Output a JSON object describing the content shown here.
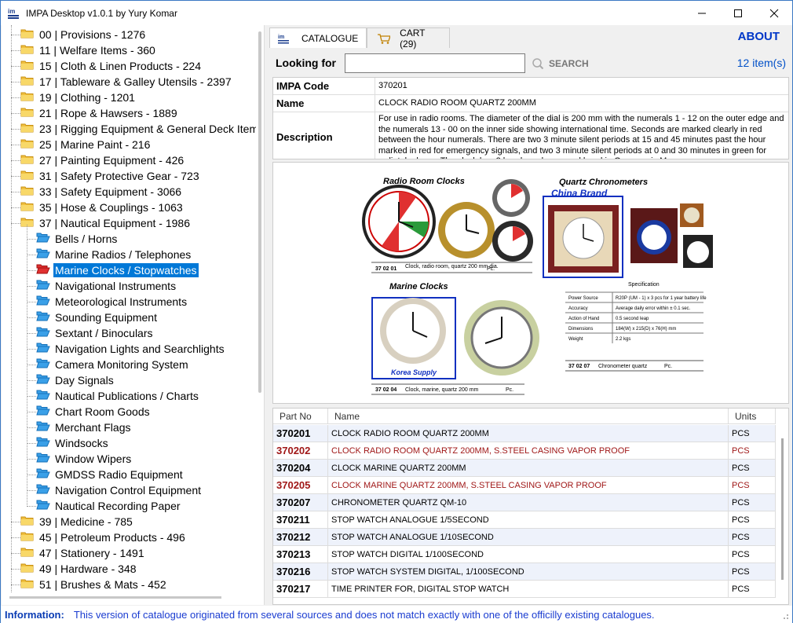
{
  "window": {
    "title": "IMPA Desktop v1.0.1 by Yury Komar",
    "app_icon_text": "im"
  },
  "tree": {
    "categories_top": [
      {
        "label": "00 |   Provisions - 1276"
      },
      {
        "label": "11 |   Welfare Items - 360"
      },
      {
        "label": "15 |   Cloth & Linen Products - 224"
      },
      {
        "label": "17 |   Tableware & Galley Utensils - 2397"
      },
      {
        "label": "19 |   Clothing - 1201"
      },
      {
        "label": "21 |   Rope & Hawsers - 1889"
      },
      {
        "label": "23 |   Rigging Equipment & General Deck Item"
      },
      {
        "label": "25 |   Marine Paint - 216"
      },
      {
        "label": "27 |   Painting Equipment - 426"
      },
      {
        "label": "31 |   Safety Protective Gear - 723"
      },
      {
        "label": "33 |   Safety Equipment - 3066"
      },
      {
        "label": "35 |   Hose & Couplings - 1063"
      },
      {
        "label": "37 |   Nautical Equipment - 1986"
      }
    ],
    "children": [
      {
        "label": "Bells / Horns"
      },
      {
        "label": "Marine Radios / Telephones"
      },
      {
        "label": "Marine Clocks / Stopwatches",
        "selected": true
      },
      {
        "label": "Navigational Instruments"
      },
      {
        "label": "Meteorological Instruments"
      },
      {
        "label": "Sounding Equipment"
      },
      {
        "label": "Sextant / Binoculars"
      },
      {
        "label": "Navigation Lights and Searchlights"
      },
      {
        "label": "Camera Monitoring System"
      },
      {
        "label": "Day Signals"
      },
      {
        "label": "Nautical Publications / Charts"
      },
      {
        "label": "Chart Room Goods"
      },
      {
        "label": "Merchant Flags"
      },
      {
        "label": "Windsocks"
      },
      {
        "label": "Window Wipers"
      },
      {
        "label": "GMDSS Radio Equipment"
      },
      {
        "label": "Navigation Control Equipment"
      },
      {
        "label": "Nautical Recording Paper"
      }
    ],
    "categories_bottom": [
      {
        "label": "39 |   Medicine - 785"
      },
      {
        "label": "45 |   Petroleum Products  - 496"
      },
      {
        "label": "47 |   Stationery - 1491"
      },
      {
        "label": "49 |   Hardware - 348"
      },
      {
        "label": "51 |   Brushes & Mats - 452"
      }
    ]
  },
  "tabs": {
    "catalogue": "CATALOGUE",
    "cart": "CART (29)"
  },
  "about": "ABOUT",
  "search": {
    "label": "Looking for",
    "value": "",
    "button": "SEARCH",
    "count": "12 item(s)"
  },
  "detail": {
    "code_key": "IMPA Code",
    "code_val": "370201",
    "name_key": "Name",
    "name_val": "CLOCK RADIO ROOM QUARTZ 200MM",
    "desc_key": "Description",
    "desc_val": "For use in radio rooms. The diameter of the dial is 200 mm with the numerals 1 - 12 on the outer edge and the numerals 13 - 00 on the inner side showing international time. Seconds are marked clearly in red between the hour numerals. There are two 3 minute silent periods at 15 and 45 minutes past the hour marked in red for emergency signals, and two 3 minute silent periods at 0 and 30 minutes in green for radiotelephone. The clock has 2 hands and a second hand in Gyroscopic M"
  },
  "catalog_image": {
    "radio_title": "Radio Room Clocks",
    "quartz_title": "Quartz Chronometers",
    "china_brand": "China Brand",
    "marine_title": "Marine Clocks",
    "korea_supply": "Korea Supply",
    "specification": "Specification",
    "code1": "37 02 01",
    "desc1": "Clock, radio room, quartz 200 mm dia.",
    "pc1": "Pc.",
    "code2": "37 02 04",
    "desc2": "Clock, marine, quartz 200 mm",
    "pc2": "Pc.",
    "code3": "37 02 07",
    "desc3": "Chronometer quartz",
    "pc3": "Pc.",
    "spec_rows": [
      {
        "k": "Power Source",
        "v": "R20P (UM - 1) x 3 pcs for 1 year battery life"
      },
      {
        "k": "Accuracy",
        "v": "Average daily error within ± 0.1 sec."
      },
      {
        "k": "Action of Hand",
        "v": "0.5 second leap"
      },
      {
        "k": "Dimensions",
        "v": "184(W) x 215(D) x 76(H) mm"
      },
      {
        "k": "Weight",
        "v": "2.2 kgs"
      }
    ]
  },
  "grid": {
    "headers": {
      "part": "Part No",
      "name": "Name",
      "units": "Units"
    },
    "rows": [
      {
        "part": "370201",
        "name": "CLOCK RADIO ROOM QUARTZ 200MM",
        "units": "PCS",
        "red": false
      },
      {
        "part": "370202",
        "name": "CLOCK RADIO ROOM QUARTZ 200MM, S.STEEL CASING VAPOR PROOF",
        "units": "PCS",
        "red": true
      },
      {
        "part": "370204",
        "name": "CLOCK MARINE QUARTZ 200MM",
        "units": "PCS",
        "red": false
      },
      {
        "part": "370205",
        "name": "CLOCK MARINE QUARTZ 200MM, S.STEEL CASING VAPOR PROOF",
        "units": "PCS",
        "red": true
      },
      {
        "part": "370207",
        "name": "CHRONOMETER QUARTZ QM-10",
        "units": "PCS",
        "red": false
      },
      {
        "part": "370211",
        "name": "STOP WATCH ANALOGUE 1/5SECOND",
        "units": "PCS",
        "red": false
      },
      {
        "part": "370212",
        "name": "STOP WATCH ANALOGUE 1/10SECOND",
        "units": "PCS",
        "red": false
      },
      {
        "part": "370213",
        "name": "STOP WATCH DIGITAL 1/100SECOND",
        "units": "PCS",
        "red": false
      },
      {
        "part": "370216",
        "name": "STOP WATCH SYSTEM DIGITAL, 1/100SECOND",
        "units": "PCS",
        "red": false
      },
      {
        "part": "370217",
        "name": "TIME PRINTER FOR, DIGITAL STOP WATCH",
        "units": "PCS",
        "red": false
      }
    ]
  },
  "info": {
    "key": "Information:",
    "value": "This version of catalogue originated from several sources and does not match exactly with one of the officilly existing catalogues."
  }
}
